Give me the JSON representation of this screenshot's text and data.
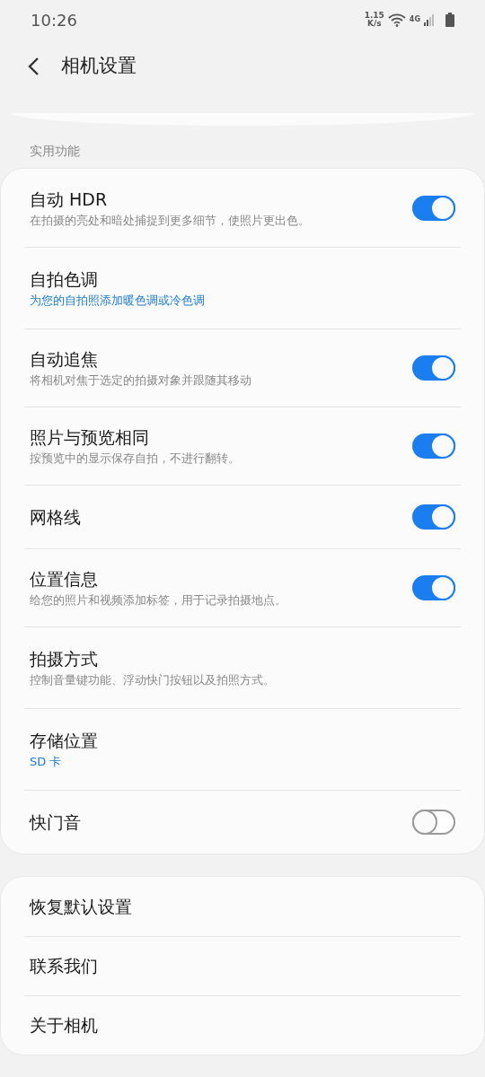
{
  "status_bar": {
    "time": "10:26",
    "speed_value": "1.15",
    "speed_unit": "K/s",
    "network": "4G"
  },
  "header": {
    "title": "相机设置"
  },
  "sections": [
    {
      "title": "实用功能",
      "items": [
        {
          "kind": "toggle",
          "title": "自动 HDR",
          "summary": "在拍摄的亮处和暗处捕捉到更多细节，使照片更出色。",
          "on": true
        },
        {
          "kind": "link",
          "title": "自拍色调",
          "value": "为您的自拍照添加暖色调或冷色调"
        },
        {
          "kind": "toggle",
          "title": "自动追焦",
          "summary": "将相机对焦于选定的拍摄对象并跟随其移动",
          "on": true
        },
        {
          "kind": "toggle",
          "title": "照片与预览相同",
          "summary": "按预览中的显示保存自拍，不进行翻转。",
          "on": true
        },
        {
          "kind": "toggle",
          "title": "网格线",
          "on": true
        },
        {
          "kind": "toggle",
          "title": "位置信息",
          "summary": "给您的照片和视频添加标签，用于记录拍摄地点。",
          "on": true
        },
        {
          "kind": "link",
          "title": "拍摄方式",
          "summary": "控制音量键功能、浮动快门按钮以及拍照方式。"
        },
        {
          "kind": "link",
          "title": "存储位置",
          "value": "SD 卡"
        },
        {
          "kind": "toggle",
          "title": "快门音",
          "on": false
        }
      ]
    },
    {
      "items": [
        {
          "kind": "link",
          "title": "恢复默认设置"
        },
        {
          "kind": "link",
          "title": "联系我们"
        },
        {
          "kind": "link",
          "title": "关于相机"
        }
      ]
    }
  ]
}
